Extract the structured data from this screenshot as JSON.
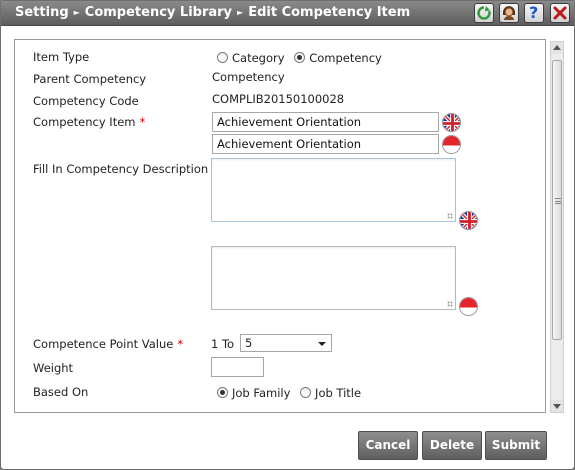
{
  "breadcrumb": {
    "items": [
      "Setting",
      "Competency Library",
      "Edit Competency Item"
    ],
    "separator": "►"
  },
  "toolbar_icons": [
    "refresh-icon",
    "support-agent-icon",
    "help-icon",
    "close-icon"
  ],
  "help_label": "?",
  "form": {
    "item_type": {
      "label": "Item Type",
      "options": [
        "Category",
        "Competency"
      ],
      "selected": "Competency"
    },
    "parent_competency": {
      "label": "Parent Competency",
      "value": "Competency"
    },
    "competency_code": {
      "label": "Competency Code",
      "value": "COMPLIB20150100028"
    },
    "competency_item": {
      "label": "Competency Item",
      "required_mark": "*",
      "value_en": "Achievement Orientation",
      "value_id": "Achievement Orientation"
    },
    "description": {
      "label": "Fill In Competency Description",
      "value_en": "",
      "value_id": ""
    },
    "competence_point": {
      "label": "Competence Point Value",
      "required_mark": "*",
      "range_prefix": "1 To",
      "selected": "5"
    },
    "weight": {
      "label": "Weight",
      "value": ""
    },
    "based_on": {
      "label": "Based On",
      "options": [
        "Job Family",
        "Job Title"
      ],
      "selected": "Job Family"
    }
  },
  "buttons": {
    "cancel": "Cancel",
    "delete": "Delete",
    "submit": "Submit"
  },
  "colors": {
    "title_bar": "#6f6f6f",
    "required": "#cc0000",
    "button": "#707070"
  }
}
